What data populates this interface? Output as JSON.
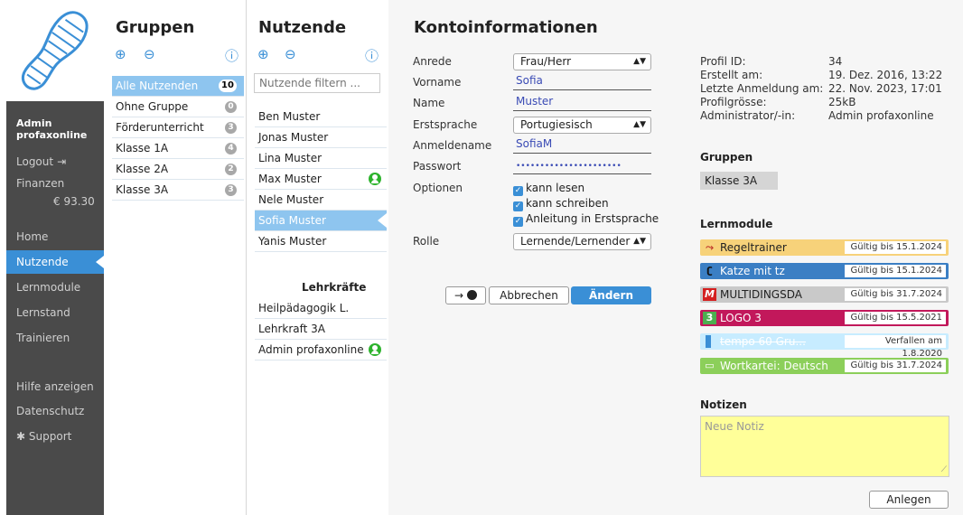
{
  "nav": {
    "user_line1": "Admin",
    "user_line2": "profaxonline",
    "logout": "Logout",
    "finance_label": "Finanzen",
    "finance_value": "€ 93.30",
    "items": [
      "Home",
      "Nutzende",
      "Lernmodule",
      "Lernstand",
      "Trainieren"
    ],
    "bottom": [
      "Hilfe anzeigen",
      "Datenschutz",
      "Support"
    ],
    "active": "Nutzende"
  },
  "groups": {
    "title": "Gruppen",
    "items": [
      {
        "label": "Alle Nutzenden",
        "count": "10"
      },
      {
        "label": "Ohne Gruppe",
        "count": "0"
      },
      {
        "label": "Förderunterricht",
        "count": "3"
      },
      {
        "label": "Klasse 1A",
        "count": "4"
      },
      {
        "label": "Klasse 2A",
        "count": "2"
      },
      {
        "label": "Klasse 3A",
        "count": "3"
      }
    ]
  },
  "users": {
    "title": "Nutzende",
    "filter_placeholder": "Nutzende filtern ...",
    "items": [
      "Ben Muster",
      "Jonas Muster",
      "Lina Muster",
      "Max Muster",
      "Nele Muster",
      "Sofia Muster",
      "Yanis Muster"
    ],
    "teachers_heading": "Lehrkräfte",
    "teachers": [
      "Heilpädagogik L.",
      "Lehrkraft 3A",
      "Admin profaxonline"
    ]
  },
  "account": {
    "title": "Kontoinformationen",
    "labels": {
      "salutation": "Anrede",
      "firstname": "Vorname",
      "name": "Name",
      "language": "Erstsprache",
      "login": "Anmeldename",
      "password": "Passwort",
      "options": "Optionen",
      "role": "Rolle"
    },
    "salutation": "Frau/Herr",
    "firstname": "Sofia",
    "name": "Muster",
    "language": "Portugiesisch",
    "login": "SofiaM",
    "password": "••••••••••••••••••••••",
    "options": [
      "kann lesen",
      "kann schreiben",
      "Anleitung in Erstsprache"
    ],
    "role": "Lernende/Lernender",
    "btn_cancel": "Abbrechen",
    "btn_change": "Ändern",
    "btn_login_as": "→"
  },
  "profile": {
    "labels": [
      "Profil ID:",
      "Erstellt am:",
      "Letzte Anmeldung am:",
      "Profilgrösse:",
      "Administrator/-in:"
    ],
    "values": [
      "34",
      "19. Dez. 2016, 13:22",
      "22. Nov. 2023, 17:01",
      "25kB",
      "Admin profaxonline"
    ]
  },
  "groups_section": {
    "title": "Gruppen",
    "chip": "Klasse 3A"
  },
  "modules": {
    "title": "Lernmodule",
    "items": [
      {
        "name": "Regeltrainer",
        "valid": "Gültig bis 15.1.2024",
        "color": "#f7d27a",
        "icon": "regeltrainer-icon"
      },
      {
        "name": "Katze mit tz",
        "valid": "Gültig bis 15.1.2024",
        "color": "#3b7fc4",
        "icon": "cat-icon"
      },
      {
        "name": "MULTIDINGSDA",
        "valid": "Gültig bis 31.7.2024",
        "color": "#c9c9c9",
        "icon": "multidingsda-icon"
      },
      {
        "name": "LOGO 3",
        "valid": "Gültig bis 15.5.2021",
        "color": "#c2185b",
        "icon": "logo-icon"
      },
      {
        "name": "tempo 60 Gru...",
        "valid": "Verfallen am 1.8.2020",
        "color": "#c7ecff",
        "icon": "tempo-icon"
      },
      {
        "name": "Wortkartei: Deutsch",
        "valid": "Gültig bis 31.7.2024",
        "color": "#8ccf5a",
        "icon": "folder-icon"
      }
    ]
  },
  "notes": {
    "title": "Notizen",
    "placeholder": "Neue Notiz",
    "btn": "Anlegen"
  }
}
